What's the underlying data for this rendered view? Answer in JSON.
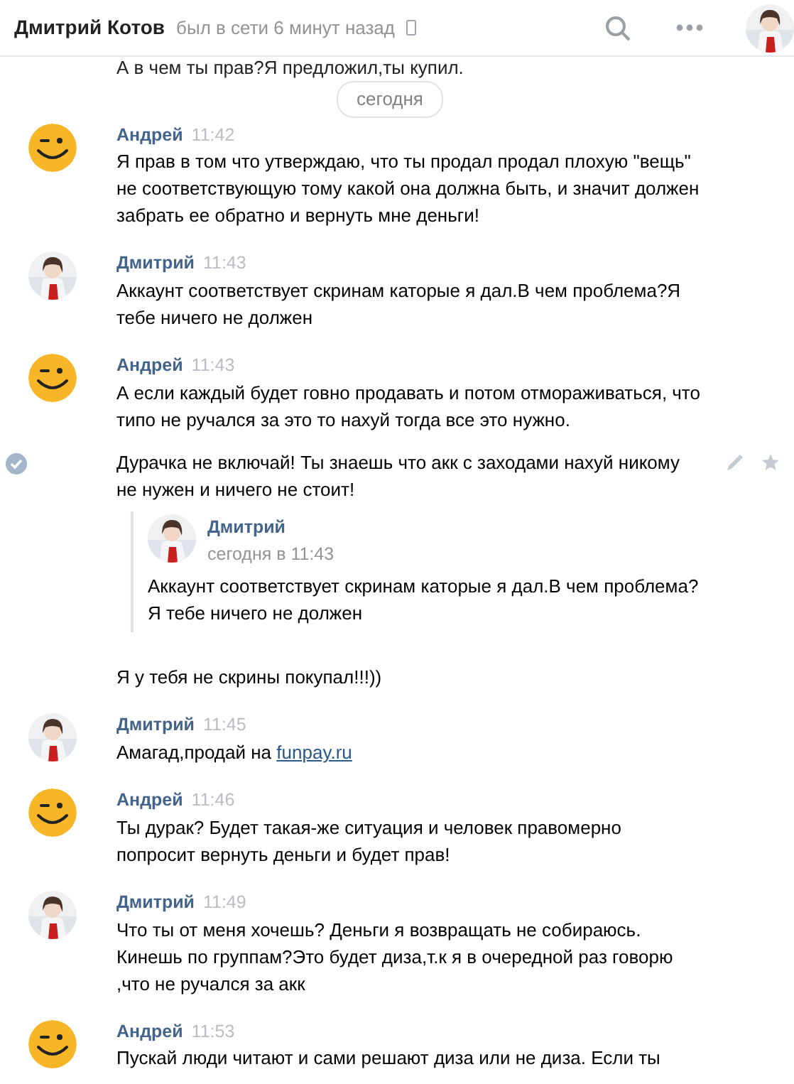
{
  "header": {
    "title": "Дмитрий Котов",
    "status": "был в сети 6 минут назад"
  },
  "top_partial": {
    "text": "А в чем ты прав?Я предложил,ты купил."
  },
  "date_divider": "сегодня",
  "groups": [
    {
      "author": "Андрей",
      "kind": "smiley",
      "time": "11:42",
      "messages": [
        {
          "text": "Я прав в том что утверждаю, что ты продал продал плохую \"вещь\" не соответствующую тому какой она должна быть, и значит должен забрать ее обратно и вернуть мне деньги!",
          "selected": false
        }
      ]
    },
    {
      "author": "Дмитрий",
      "time": "11:43",
      "messages": [
        {
          "text": "Аккаунт соответствует скринам каторые я дал.В чем проблема?Я тебе ничего не должен",
          "selected": false
        }
      ]
    },
    {
      "author": "Андрей",
      "kind": "smiley",
      "time": "11:43",
      "messages": [
        {
          "text": "А если каждый будет говно продавать и потом отмораживаться, что типо не ручался за это то нахуй тогда все это нужно.",
          "selected": false
        },
        {
          "text": "Дурачка не включай! Ты знаешь что акк с заходами нахуй никому не нужен и ничего не стоит!",
          "selected": true,
          "forwarded": {
            "author": "Дмитрий",
            "time": "сегодня в 11:43",
            "text": "Аккаунт соответствует скринам каторые я дал.В чем проблема? Я тебе ничего не должен"
          },
          "after": "Я у тебя не скрины покупал!!!))"
        }
      ]
    },
    {
      "author": "Дмитрий",
      "time": "11:45",
      "messages": [
        {
          "text": "Амагад,продай на",
          "link": "funpay.ru",
          "selected": false
        }
      ]
    },
    {
      "author": "Андрей",
      "kind": "smiley",
      "time": "11:46",
      "messages": [
        {
          "text": "Ты дурак? Будет такая-же ситуация и человек правомерно попросит вернуть деньги и будет прав!",
          "selected": false
        }
      ]
    },
    {
      "author": "Дмитрий",
      "time": "11:49",
      "messages": [
        {
          "text": "Что ты от меня хочешь? Деньги я возвращать не собираюсь. Кинешь по группам?Это будет диза,т.к я в очередной раз говорю ,что не ручался за акк",
          "selected": false
        }
      ]
    },
    {
      "author": "Андрей",
      "kind": "smiley",
      "time": "11:53",
      "messages": [
        {
          "text": "Пускай люди читают и сами решают диза или не диза. Если ты",
          "selected": false
        }
      ]
    }
  ]
}
